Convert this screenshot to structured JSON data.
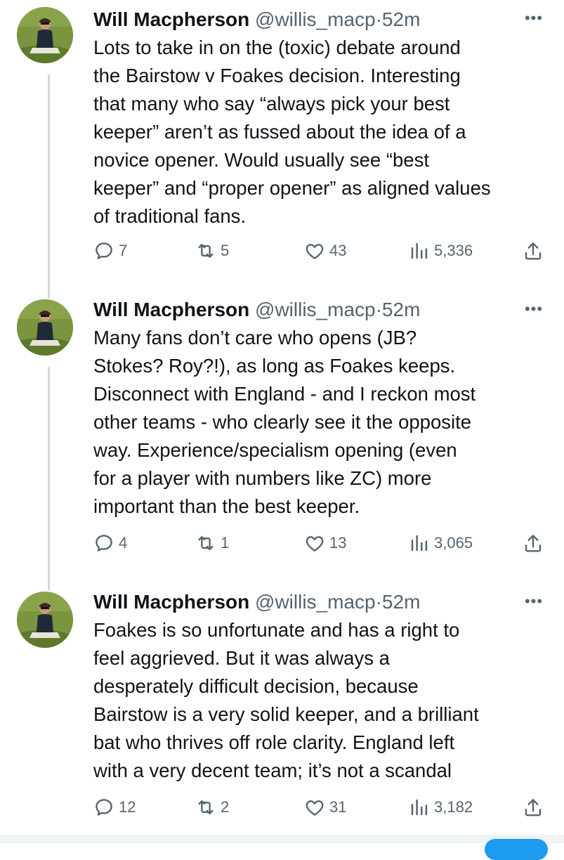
{
  "tweets": [
    {
      "name": "Will Macpherson",
      "handle": "@willis_macp",
      "time": "52m",
      "text_lines": [
        "Lots to take in on the (toxic) debate around",
        "the Bairstow v Foakes decision. Interesting",
        "that many who say “always pick your best",
        "keeper” aren’t as fussed about the idea of a",
        "novice opener. Would usually see “best",
        "keeper” and “proper opener” as aligned values",
        "of traditional fans."
      ],
      "replies": "7",
      "retweets": "5",
      "likes": "43",
      "views": "5,336"
    },
    {
      "name": "Will Macpherson",
      "handle": "@willis_macp",
      "time": "52m",
      "text_lines": [
        "Many fans don’t care who opens (JB?",
        "Stokes? Roy?!), as long as Foakes keeps.",
        "Disconnect with England - and I reckon most",
        "other teams - who clearly see it the opposite",
        "way. Experience/specialism opening (even",
        "for a player with numbers like ZC) more",
        "important than the best keeper."
      ],
      "replies": "4",
      "retweets": "1",
      "likes": "13",
      "views": "3,065"
    },
    {
      "name": "Will Macpherson",
      "handle": "@willis_macp",
      "time": "52m",
      "text_lines": [
        "Foakes is so unfortunate and has a right to",
        "feel aggrieved. But it was always a",
        "desperately difficult decision, because",
        "Bairstow is a very solid keeper, and a brilliant",
        "bat who thrives off role clarity. England left",
        "with a very decent team; it’s not a scandal"
      ],
      "replies": "12",
      "retweets": "2",
      "likes": "31",
      "views": "3,182"
    }
  ],
  "separator": "·",
  "more_glyph": "•••",
  "icons": {
    "reply": "reply-icon",
    "retweet": "retweet-icon",
    "like": "heart-icon",
    "views": "views-icon",
    "share": "share-icon",
    "more": "more-icon"
  },
  "colors": {
    "text": "#0f1419",
    "secondary": "#536471",
    "thread_line": "#cfd9de",
    "accent": "#1d9bf0"
  }
}
